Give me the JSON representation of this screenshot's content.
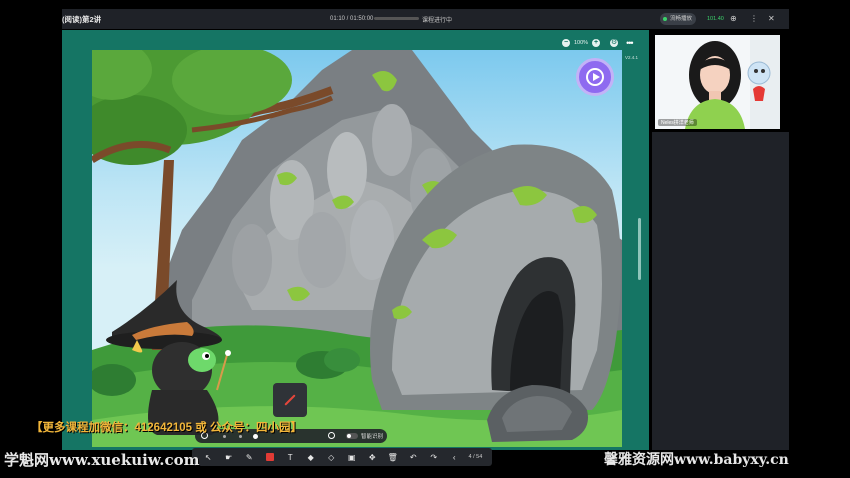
{
  "topbar": {
    "course_title": "(阅读)第2讲",
    "timer": "01:10 / 01:50:00",
    "status": "课程进行中",
    "net_label": "流畅播放",
    "net_value": "101.40"
  },
  "stage": {
    "zoom": "100%",
    "version": "V2.4.1",
    "page_indicator": "4 / 54",
    "smart_label": "智能识别"
  },
  "webcam": {
    "name_tag": "Neles拼洋老师"
  },
  "toolbar": {
    "tools": [
      "select-icon",
      "pointer-icon",
      "pen-icon",
      "color-icon",
      "text-icon",
      "eraser-icon",
      "shape-icon",
      "screenshot-icon",
      "move-icon",
      "delete-icon",
      "undo-icon",
      "redo-icon",
      "prev-page-icon"
    ]
  },
  "overlay": {
    "promo": "【更多课程加微信：412642105 或 公众号：四小园】",
    "watermark_left": "学魁网www.xuekuiw.com",
    "watermark_right": "馨雅资源网www.babyxy.cn"
  },
  "colors": {
    "stage_frame": "#157564",
    "accent_play": "#8e6af0",
    "pen_red": "#e23b35",
    "promo_text": "#f2b63a"
  }
}
